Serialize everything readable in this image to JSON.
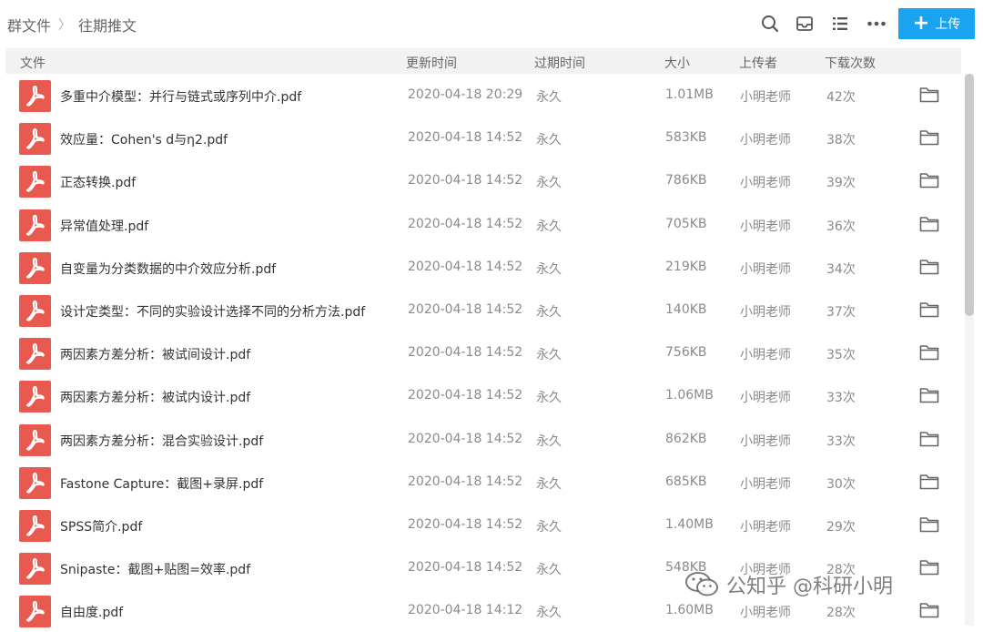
{
  "breadcrumb": [
    "群文件",
    "往期推文"
  ],
  "toolbar": {
    "upload_label": "上传",
    "icons": [
      "search-icon",
      "inbox-icon",
      "list-view-icon",
      "more-icon"
    ],
    "accent_color": "#1aa3f0"
  },
  "columns": [
    "文件",
    "更新时间",
    "过期时间",
    "大小",
    "上传者",
    "下载次数"
  ],
  "files": [
    {
      "name": "多重中介模型：并行与链式或序列中介.pdf",
      "updated": "2020-04-18 20:29",
      "expiry": "永久",
      "size": "1.01MB",
      "uploader": "小明老师",
      "downloads": "42次"
    },
    {
      "name": "效应量：Cohen's d与η2.pdf",
      "updated": "2020-04-18 14:52",
      "expiry": "永久",
      "size": "583KB",
      "uploader": "小明老师",
      "downloads": "38次"
    },
    {
      "name": "正态转换.pdf",
      "updated": "2020-04-18 14:52",
      "expiry": "永久",
      "size": "786KB",
      "uploader": "小明老师",
      "downloads": "39次"
    },
    {
      "name": "异常值处理.pdf",
      "updated": "2020-04-18 14:52",
      "expiry": "永久",
      "size": "705KB",
      "uploader": "小明老师",
      "downloads": "36次"
    },
    {
      "name": "自变量为分类数据的中介效应分析.pdf",
      "updated": "2020-04-18 14:52",
      "expiry": "永久",
      "size": "219KB",
      "uploader": "小明老师",
      "downloads": "34次"
    },
    {
      "name": "设计定类型：不同的实验设计选择不同的分析方法.pdf",
      "updated": "2020-04-18 14:52",
      "expiry": "永久",
      "size": "140KB",
      "uploader": "小明老师",
      "downloads": "37次"
    },
    {
      "name": "两因素方差分析：被试间设计.pdf",
      "updated": "2020-04-18 14:52",
      "expiry": "永久",
      "size": "756KB",
      "uploader": "小明老师",
      "downloads": "35次"
    },
    {
      "name": "两因素方差分析：被试内设计.pdf",
      "updated": "2020-04-18 14:52",
      "expiry": "永久",
      "size": "1.06MB",
      "uploader": "小明老师",
      "downloads": "33次"
    },
    {
      "name": "两因素方差分析：混合实验设计.pdf",
      "updated": "2020-04-18 14:52",
      "expiry": "永久",
      "size": "862KB",
      "uploader": "小明老师",
      "downloads": "33次"
    },
    {
      "name": "Fastone Capture：截图+录屏.pdf",
      "updated": "2020-04-18 14:52",
      "expiry": "永久",
      "size": "685KB",
      "uploader": "小明老师",
      "downloads": "30次"
    },
    {
      "name": "SPSS简介.pdf",
      "updated": "2020-04-18 14:52",
      "expiry": "永久",
      "size": "1.40MB",
      "uploader": "小明老师",
      "downloads": "29次"
    },
    {
      "name": "Snipaste：截图+贴图=效率.pdf",
      "updated": "2020-04-18 14:52",
      "expiry": "永久",
      "size": "548KB",
      "uploader": "小明老师",
      "downloads": "28次"
    },
    {
      "name": "自由度.pdf",
      "updated": "2020-04-18 14:12",
      "expiry": "永久",
      "size": "1.60MB",
      "uploader": "小明老师",
      "downloads": "28次"
    }
  ],
  "watermark": "公知乎 @科研小明"
}
